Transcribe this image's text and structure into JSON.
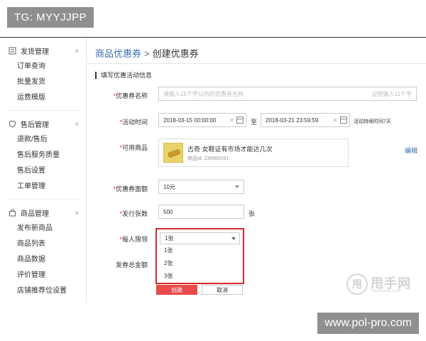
{
  "watermarks": {
    "top_left": "TG: MYYJJPP",
    "bottom_right": "www.pol-pro.com"
  },
  "sidebar": {
    "groups": [
      {
        "title": "发货管理",
        "icon": "list-icon",
        "items": [
          "订单查询",
          "批量发货",
          "运费模版"
        ]
      },
      {
        "title": "售后管理",
        "icon": "shield-icon",
        "items": [
          "退款/售后",
          "售后服务质量",
          "售后设置",
          "工单管理"
        ]
      },
      {
        "title": "商品管理",
        "icon": "bag-icon",
        "items": [
          "发布新商品",
          "商品列表",
          "商品数据",
          "评价管理",
          "店铺推荐位设置"
        ]
      }
    ]
  },
  "breadcrumb": {
    "parent": "商品优惠券",
    "sep": ">",
    "current": "创建优惠券"
  },
  "section_title": "填写优惠活动信息",
  "form": {
    "name": {
      "label": "优惠券名称",
      "placeholder": "请输入15个字以内的优惠券名称",
      "hint": "证明输入11个字"
    },
    "time": {
      "label": "活动时间",
      "start": "2018-03-15 00:00:00",
      "to": "至",
      "end": "2018-03-21 23:59:59",
      "note": "活动持续时间7天"
    },
    "product": {
      "label": "可用商品",
      "name": "古奇 女鞋证有市场才能达几次",
      "id": "商品id: 236560261",
      "edit": "编辑"
    },
    "amount": {
      "label": "优惠券面额",
      "value": "10元"
    },
    "count": {
      "label": "发行张数",
      "value": "500",
      "unit": "张"
    },
    "limit": {
      "label": "每人限领",
      "selected": "1张",
      "options": [
        "1张",
        "2张",
        "3张"
      ]
    },
    "total": {
      "label": "发券总金额"
    }
  },
  "buttons": {
    "create": "创建",
    "cancel": "取消"
  },
  "logo": {
    "mark": "甩",
    "brand": "甩手网",
    "sub": "shuaishou.com"
  },
  "colors": {
    "accent_blue": "#3a6fb0",
    "highlight_red": "#d42a2a",
    "button_red": "#e84a4a"
  }
}
